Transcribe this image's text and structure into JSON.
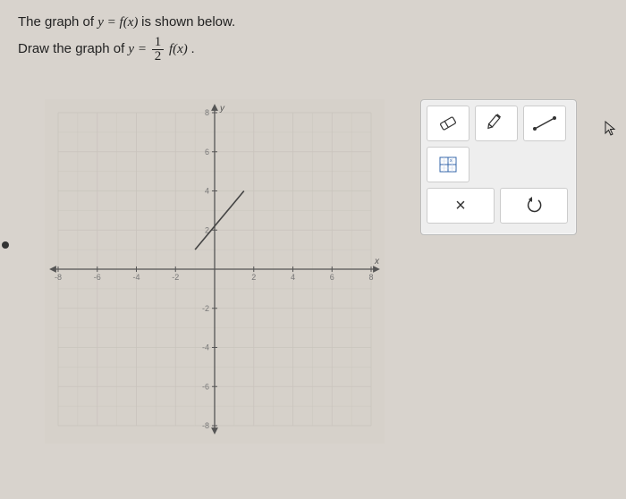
{
  "prompt": {
    "line1_pre": "The graph of ",
    "line1_eq_lhs": "y",
    "line1_eq_rhs": "f(x)",
    "line1_post": " is shown below.",
    "line2_pre": "Draw the graph of ",
    "line2_eq_lhs": "y",
    "line2_frac_num": "1",
    "line2_frac_den": "2",
    "line2_eq_rhs": "f(x)",
    "line2_post": "."
  },
  "tools": {
    "eraser": "eraser-icon",
    "pencil": "pencil-icon",
    "line": "line-icon",
    "grid": "grid-icon",
    "delete": "×",
    "reset": "↺"
  },
  "chart_data": {
    "type": "line",
    "title": "",
    "xlabel": "x",
    "ylabel": "y",
    "xlim": [
      -8,
      8
    ],
    "ylim": [
      -8,
      8
    ],
    "xticks": [
      -8,
      -6,
      -4,
      -2,
      2,
      4,
      6,
      8
    ],
    "yticks": [
      -8,
      -6,
      -4,
      -2,
      2,
      4,
      6,
      8
    ],
    "grid": true,
    "series": [
      {
        "name": "drawn_segment",
        "type": "line",
        "x": [
          -1,
          1.5
        ],
        "y": [
          1,
          4
        ]
      }
    ]
  }
}
